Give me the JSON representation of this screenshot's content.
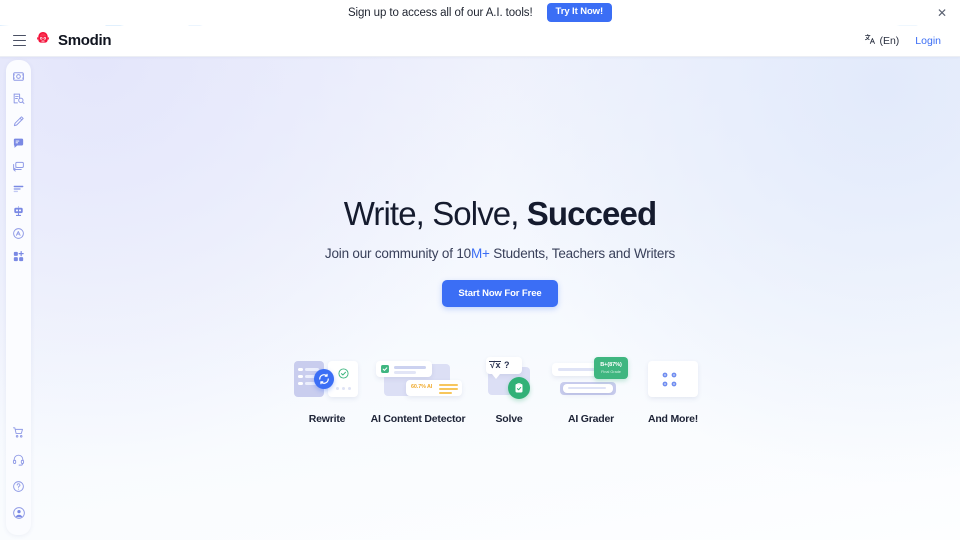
{
  "promo": {
    "text": "Sign up to access all of our A.I. tools!",
    "button_label": "Try It Now!",
    "close_icon": "close-icon"
  },
  "navbar": {
    "menu_icon": "hamburger-menu-icon",
    "logo_icon": "smodin-robot-logo-icon",
    "brand": "Smodin",
    "language": {
      "icon": "translate-icon",
      "label": "(En)"
    },
    "login_label": "Login"
  },
  "sidebar": {
    "items": [
      {
        "icon": "image-tool-icon",
        "name": "sidebar-item-image-tool"
      },
      {
        "icon": "detector-search-icon",
        "name": "sidebar-item-detector"
      },
      {
        "icon": "pencil-rewrite-icon",
        "name": "sidebar-item-rewrite"
      },
      {
        "icon": "chat-message-icon",
        "name": "sidebar-item-chat"
      },
      {
        "icon": "translate-card-icon",
        "name": "sidebar-item-translate"
      },
      {
        "icon": "summarize-lines-icon",
        "name": "sidebar-item-summarize"
      },
      {
        "icon": "grader-robot-icon",
        "name": "sidebar-item-grader"
      },
      {
        "icon": "plagiarism-circle-icon",
        "name": "sidebar-item-plagiarism"
      },
      {
        "icon": "more-tools-grid-icon",
        "name": "sidebar-item-more-tools"
      }
    ],
    "bottom_items": [
      {
        "icon": "shopping-cart-icon",
        "name": "sidebar-item-cart"
      },
      {
        "icon": "headset-support-icon",
        "name": "sidebar-item-support"
      },
      {
        "icon": "help-question-icon",
        "name": "sidebar-item-help"
      },
      {
        "icon": "user-account-icon",
        "name": "sidebar-item-account"
      }
    ]
  },
  "hero": {
    "title_regular": "Write, Solve, ",
    "title_bold": "Succeed",
    "sub_prefix": "Join our community of ",
    "sub_number": "10",
    "sub_accent": "M+",
    "sub_suffix": " Students, Teachers and Writers",
    "cta_label": "Start Now For Free"
  },
  "features": [
    {
      "label": "Rewrite",
      "name": "feature-rewrite",
      "art": "rewrite-documents-icon",
      "badge": ""
    },
    {
      "label": "AI Content Detector",
      "name": "feature-ai-content-detector",
      "art": "ai-detector-cards-icon",
      "badge": "60.7% AI"
    },
    {
      "label": "Solve",
      "name": "feature-solve",
      "art": "solve-math-bubble-icon",
      "badge": "√x  ?"
    },
    {
      "label": "AI Grader",
      "name": "feature-ai-grader",
      "art": "ai-grader-badge-icon",
      "badge": "B+(87%)",
      "badge_sub": "Final Grade"
    },
    {
      "label": "And More!",
      "name": "feature-and-more",
      "art": "more-dots-card-icon",
      "badge": ""
    }
  ],
  "colors": {
    "accent_blue": "#3b6ef5",
    "green": "#3fb680",
    "yellow": "#f5b544",
    "text_dark": "#151b2e",
    "rail_icon": "#8f9ae6"
  }
}
